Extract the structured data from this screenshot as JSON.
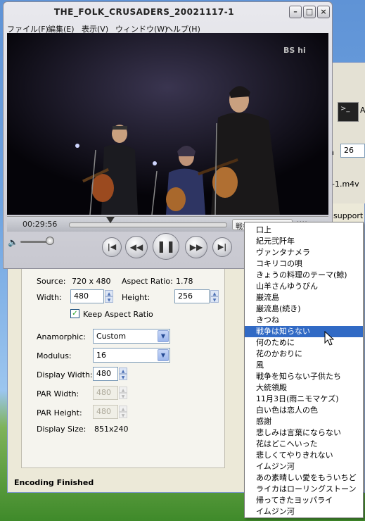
{
  "player": {
    "title": "THE_FOLK_CRUSADERS_20021117-1",
    "menu": [
      "ファイル(F)",
      "編集(E)",
      "表示(V)",
      "ウィンドウ(W)",
      "ヘルプ(H)"
    ],
    "channel_logo": "BS hi",
    "time": "00:29:56",
    "chapter_button": "戦争は知ら",
    "progress_fraction": 0.26
  },
  "encoder": {
    "source_label": "Source:",
    "source_value": "720 x 480",
    "aspect_label": "Aspect Ratio:",
    "aspect_value": "1.78",
    "width_label": "Width:",
    "width_value": "480",
    "height_label": "Height:",
    "height_value": "256",
    "keep_aspect_label": "Keep Aspect Ratio",
    "keep_aspect_checked": true,
    "anamorphic_label": "Anamorphic:",
    "anamorphic_value": "Custom",
    "modulus_label": "Modulus:",
    "modulus_value": "16",
    "display_width_label": "Display Width:",
    "display_width_value": "480",
    "par_width_label": "PAR Width:",
    "par_width_value": "480",
    "par_height_label": "PAR Height:",
    "par_height_value": "480",
    "display_size_label": "Display Size:",
    "display_size_value": "851x240",
    "right_field_label": "h",
    "right_field_value": "26",
    "file_suffix": "-1.m4v",
    "support_label": "support",
    "terminal_label": "A",
    "status": "Encoding Finished"
  },
  "chapters": [
    "口上",
    "紀元弐阡年",
    "ヴァンタナメラ",
    "コキリコの唄",
    "きょうの料理のテーマ(鯨)",
    "山羊さんゆうびん",
    "巌流島",
    "巌流島(続き)",
    "きつね",
    "戦争は知らない",
    "何のために",
    "花のかおりに",
    "風",
    "戦争を知らない子供たち",
    "大統領殿",
    "11月3日(雨ニモマケズ)",
    "白い色は恋人の色",
    "感謝",
    "悲しみは言葉にならない",
    "花はどこへいった",
    "悲しくてやりきれない",
    "イムジン河",
    "あの素晴しい愛をもういちど",
    "ライカはローリングストーン",
    "帰ってきたヨッパライ",
    "イムジン河"
  ],
  "selected_chapter_index": 9,
  "colors": {
    "selection": "#316ac5",
    "desktop_sky": "#6fa3e0",
    "video_bg": "#050409"
  }
}
